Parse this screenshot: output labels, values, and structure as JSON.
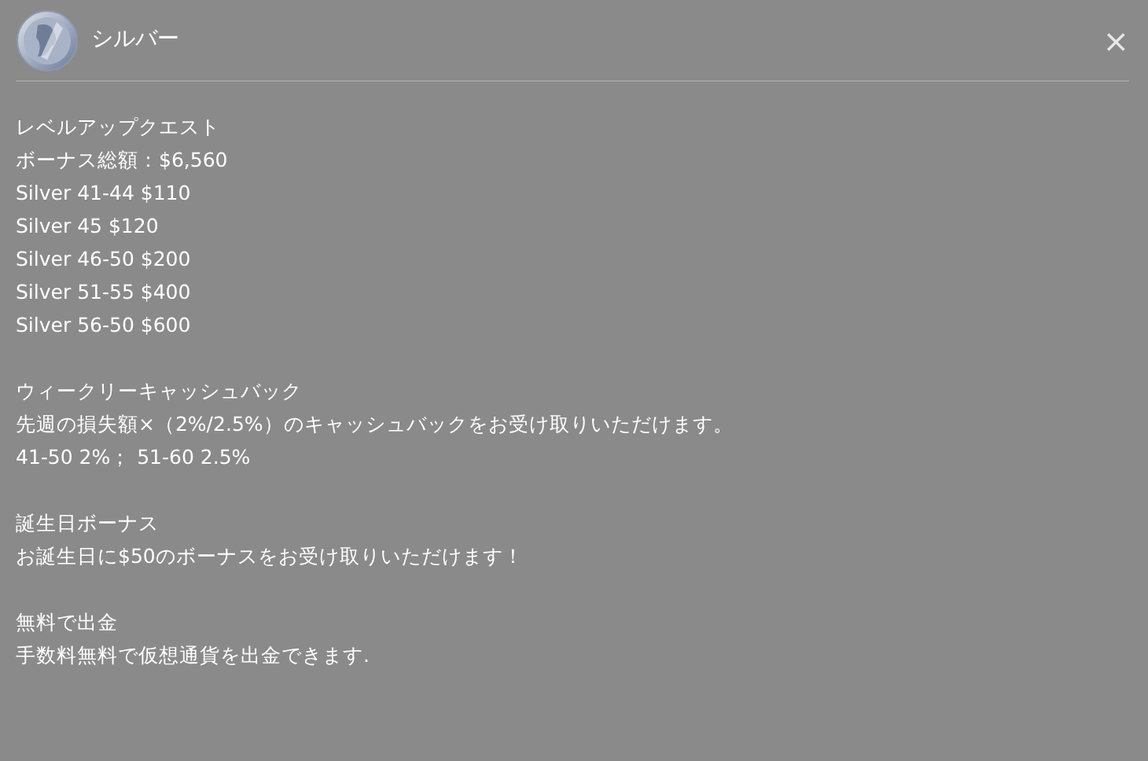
{
  "header": {
    "title": "シルバー",
    "close": "×"
  },
  "sections": [
    {
      "lines": [
        "レベルアップクエスト",
        "ボーナス総額：$6,560",
        "Silver 41-44 $110",
        "Silver 45 $120",
        "Silver 46-50 $200",
        "Silver 51-55 $400",
        "Silver 56-50 $600"
      ]
    },
    {
      "lines": [
        "ウィークリーキャッシュバック",
        "先週の損失額×（2%/2.5%）のキャッシュバックをお受け取りいただけます。",
        "41-50 2%； 51-60 2.5%"
      ]
    },
    {
      "lines": [
        "誕生日ボーナス",
        "お誕生日に$50のボーナスをお受け取りいただけます！"
      ]
    },
    {
      "lines": [
        "無料で出金",
        "手数料無料で仮想通貨を出金できます."
      ]
    }
  ]
}
